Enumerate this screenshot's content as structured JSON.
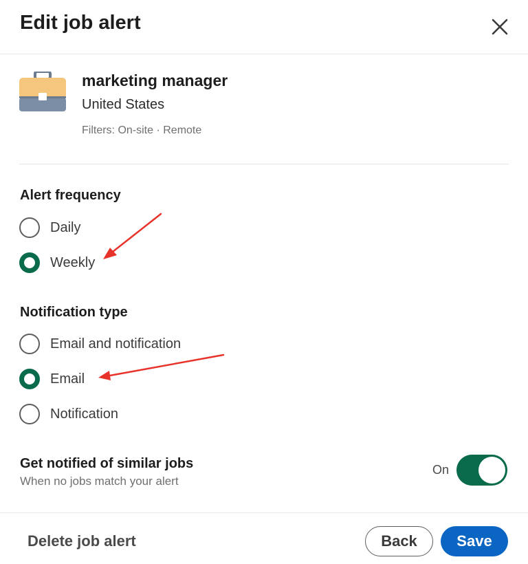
{
  "dialog": {
    "title": "Edit job alert",
    "close_icon": "close-icon"
  },
  "alert": {
    "icon": "briefcase-icon",
    "keyword": "marketing manager",
    "location": "United States",
    "filters": "Filters: On-site · Remote"
  },
  "frequency": {
    "title": "Alert frequency",
    "options": [
      {
        "label": "Daily",
        "selected": false
      },
      {
        "label": "Weekly",
        "selected": true
      }
    ]
  },
  "notification": {
    "title": "Notification type",
    "options": [
      {
        "label": "Email and notification",
        "selected": false
      },
      {
        "label": "Email",
        "selected": true
      },
      {
        "label": "Notification",
        "selected": false
      }
    ]
  },
  "similar_jobs": {
    "title": "Get notified of similar jobs",
    "subtitle": "When no jobs match your alert",
    "toggle_state": "On",
    "enabled": true
  },
  "footer": {
    "delete_label": "Delete job alert",
    "back_label": "Back",
    "save_label": "Save"
  },
  "colors": {
    "accent_green": "#0a6b4c",
    "primary_blue": "#0a66c2",
    "annotation_red": "#e8332a"
  }
}
